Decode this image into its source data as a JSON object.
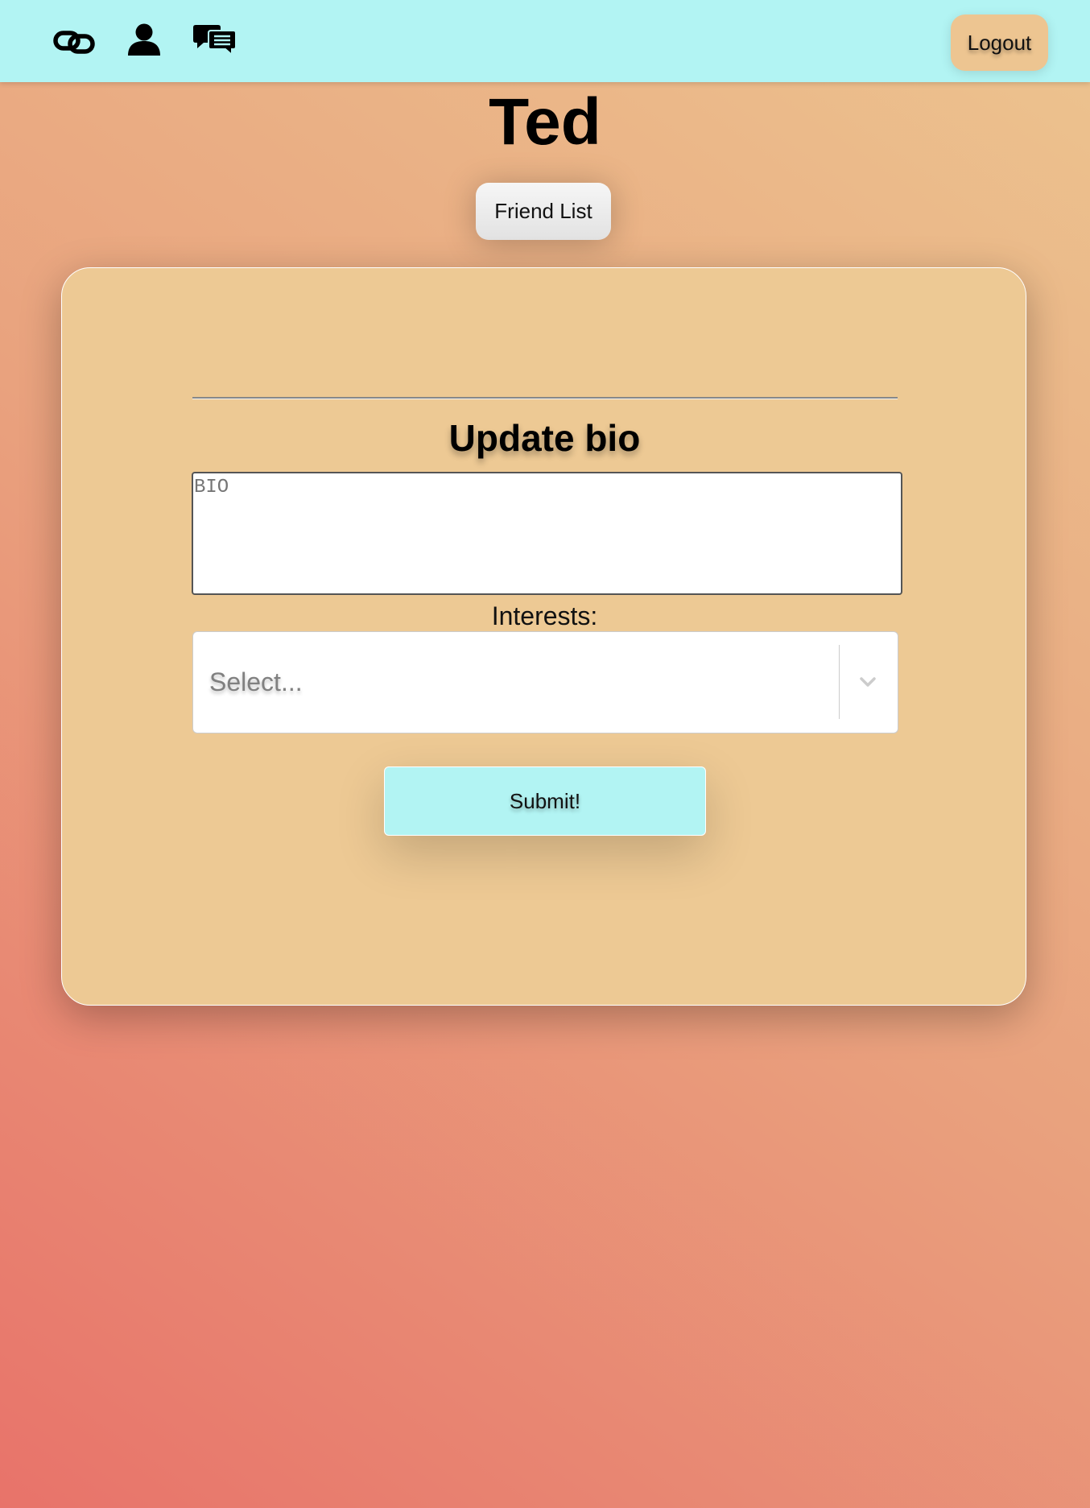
{
  "nav": {
    "icons": [
      "link-icon",
      "user-icon",
      "chat-icon"
    ],
    "logout_label": "Logout"
  },
  "profile": {
    "name": "Ted",
    "friend_list_label": "Friend List"
  },
  "bio_form": {
    "title": "Update bio",
    "bio_placeholder": "BIO",
    "bio_value": "",
    "interests_label": "Interests:",
    "interests_placeholder": "Select...",
    "submit_label": "Submit!"
  },
  "colors": {
    "topbar": "#b2f4f3",
    "card": "#edc994",
    "logout_button": "#edc591",
    "submit_button": "#b2f4f3",
    "gradient_start": "#e8736a",
    "gradient_end": "#ecc48f"
  }
}
